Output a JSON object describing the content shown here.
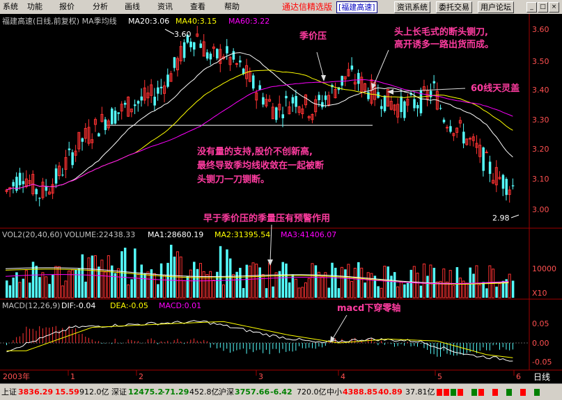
{
  "menu": [
    "系统",
    "功能",
    "报价",
    "分析",
    "画线",
    "资讯",
    "查看",
    "帮助"
  ],
  "brand": "通达信精选版",
  "symbol_box": "[福建高速]",
  "buttons": [
    "资讯系统",
    "委托交易",
    "用户论坛"
  ],
  "chart_header": {
    "title": "福建高速(日线,前复权) MA季均线",
    "ma20": "MA20:3.06",
    "ma40": "MA40:3.15",
    "ma60": "MA60:3.22"
  },
  "vol_header": {
    "label": "VOL2(20,40,60)",
    "volume": "VOLUME:22438.33",
    "ma1": "MA1:28680.19",
    "ma2": "MA2:31395.54",
    "ma3": "MA3:41406.07"
  },
  "macd_header": {
    "label": "MACD(12,26,9)",
    "dif": "DIF:-0.04",
    "dea": "DEA:-0.05",
    "macd": "MACD:0.01"
  },
  "price_axis": [
    "3.60",
    "3.50",
    "3.40",
    "3.30",
    "3.20",
    "3.10",
    "3.00"
  ],
  "vol_axis": [
    "10000"
  ],
  "vol_unit": "X10",
  "macd_axis": [
    "0.05",
    "0.00",
    "-0.05"
  ],
  "high_label": "3.60",
  "low_label": "2.98",
  "x_axis": {
    "year": "2003年",
    "months": [
      "1",
      "2",
      "3",
      "4",
      "5",
      "6"
    ],
    "period": "日线"
  },
  "annotations": {
    "jijiaya": "季价压",
    "sixty_line": "60线天灵盖",
    "knife_1": "头上长毛式的断头铡刀,",
    "knife_2": "高开诱多一路出货而成。",
    "support_1": "没有量的支持,股价不创新高,",
    "support_2": "最终导致季均线收敛在一起被断",
    "support_3": "头铡刀一刀铡断。",
    "volume_warn": "早于季价压的季量压有预警作用",
    "macd_cross": "macd下穿零轴"
  },
  "status": {
    "sh_name": "上证",
    "sh_val": "3836.29",
    "sh_chg": "15.59",
    "sh_amt": "912.0亿",
    "sz_name": "深证",
    "sz_val": "12475.2",
    "sz_chg": "-71.29",
    "sz_amt": "452.8亿",
    "hs_name": "沪深",
    "hs_val": "3757.66",
    "hs_chg": "-6.42",
    "hs_amt": "720.0亿",
    "zx_name": "中小",
    "zx_val": "4388.85",
    "zx_chg": "40.89",
    "zx_amt": "37.81亿"
  },
  "colors": {
    "up": "#ff3232",
    "down": "#54fcfc",
    "ma20": "#ffffff",
    "ma40": "#ffff00",
    "ma60": "#ff00ff",
    "annot": "#ff3ca0"
  }
}
